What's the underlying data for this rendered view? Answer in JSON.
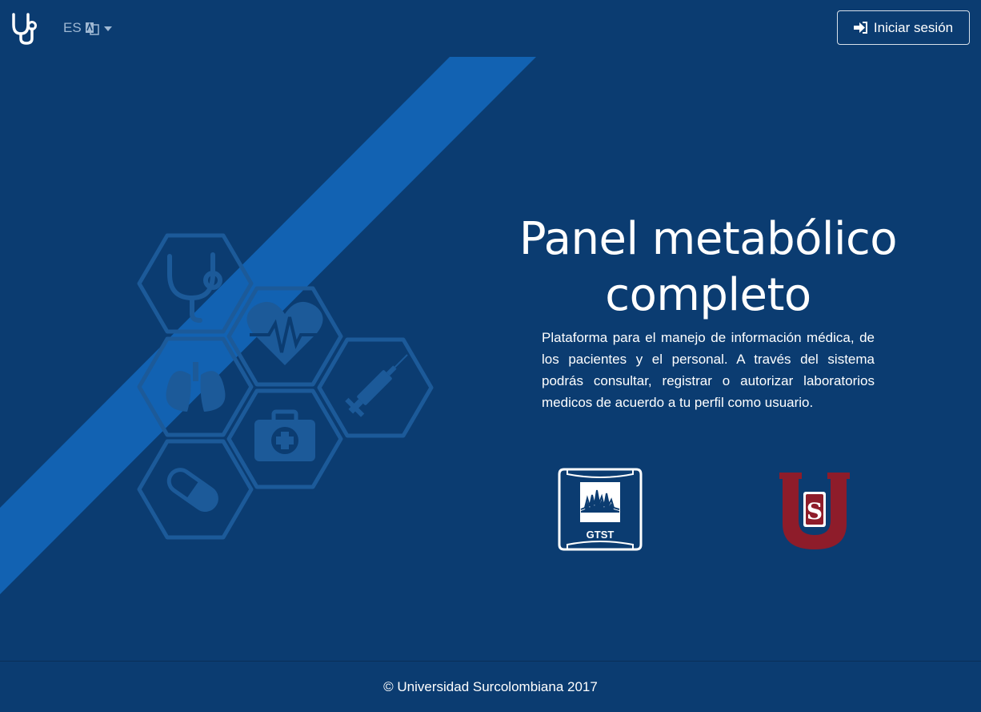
{
  "navbar": {
    "brand_icon": "stethoscope-icon",
    "language": {
      "code": "ES",
      "icon": "language-icon"
    },
    "login_button": {
      "label": "Iniciar sesión",
      "icon": "sign-in-icon"
    }
  },
  "hero": {
    "title_line1": "Panel metabólico",
    "title_line2": "completo",
    "description": "Plataforma para el manejo de información médica, de los pacientes y el personal. A través del sistema podrás consultar, registrar o autorizar laboratorios medicos de acuerdo a tu perfil como usuario.",
    "illustration_icons": [
      "stethoscope-icon",
      "heartbeat-icon",
      "lungs-icon",
      "syringe-icon",
      "first-aid-kit-icon",
      "pill-icon"
    ],
    "logos": [
      {
        "name": "gtst-logo",
        "text": "GTST"
      },
      {
        "name": "usco-logo",
        "text": "S"
      }
    ]
  },
  "footer": {
    "copyright": "© Universidad Surcolombiana 2017"
  },
  "colors": {
    "background": "#0b3c71",
    "stripe": "#1262b2",
    "hex_outline": "#1c5a99",
    "usco_red": "#8e1c2a",
    "text": "#ffffff",
    "muted": "#9fb8d3"
  }
}
